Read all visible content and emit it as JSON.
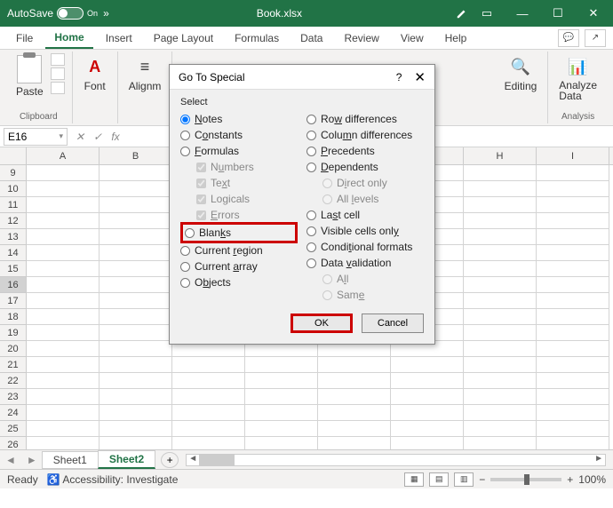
{
  "titlebar": {
    "autosave": "AutoSave",
    "autosave_state": "On",
    "more": "»",
    "filename": "Book.xlsx",
    "winbtns": {
      "min": "—",
      "max": "☐",
      "close": "✕"
    }
  },
  "tabs": {
    "file": "File",
    "home": "Home",
    "insert": "Insert",
    "pagelayout": "Page Layout",
    "formulas": "Formulas",
    "data": "Data",
    "review": "Review",
    "view": "View",
    "help": "Help"
  },
  "ribbon": {
    "clipboard": {
      "paste": "Paste",
      "label": "Clipboard"
    },
    "font": {
      "btn": "Font"
    },
    "align": {
      "btn": "Alignm"
    },
    "editing": {
      "btn": "Editing"
    },
    "analysis": {
      "btn": "Analyze\nData",
      "label": "Analysis"
    }
  },
  "namebox": "E16",
  "formula_fx": "fx",
  "columns": [
    "A",
    "B",
    "",
    "",
    "",
    "",
    "H",
    "I"
  ],
  "rows_start": 9,
  "rows_count": 20,
  "selected_row": 16,
  "sheets": {
    "s1": "Sheet1",
    "s2": "Sheet2",
    "plus": "+"
  },
  "statusbar": {
    "ready": "Ready",
    "access": "Accessibility: Investigate",
    "zoom": "100%"
  },
  "dialog": {
    "title": "Go To Special",
    "help": "?",
    "close": "✕",
    "select": "Select",
    "left": {
      "notes": "Notes",
      "constants": "Constants",
      "formulas": "Formulas",
      "numbers": "Numbers",
      "text": "Text",
      "logicals": "Logicals",
      "errors": "Errors",
      "blanks": "Blanks",
      "currentregion": "Current region",
      "currentarray": "Current array",
      "objects": "Objects"
    },
    "right": {
      "rowdiff": "Row differences",
      "coldiff": "Column differences",
      "precedents": "Precedents",
      "dependents": "Dependents",
      "directonly": "Direct only",
      "alllevels": "All levels",
      "lastcell": "Last cell",
      "visible": "Visible cells only",
      "condfmt": "Conditional formats",
      "datavalid": "Data validation",
      "all": "All",
      "same": "Same"
    },
    "ok": "OK",
    "cancel": "Cancel"
  }
}
